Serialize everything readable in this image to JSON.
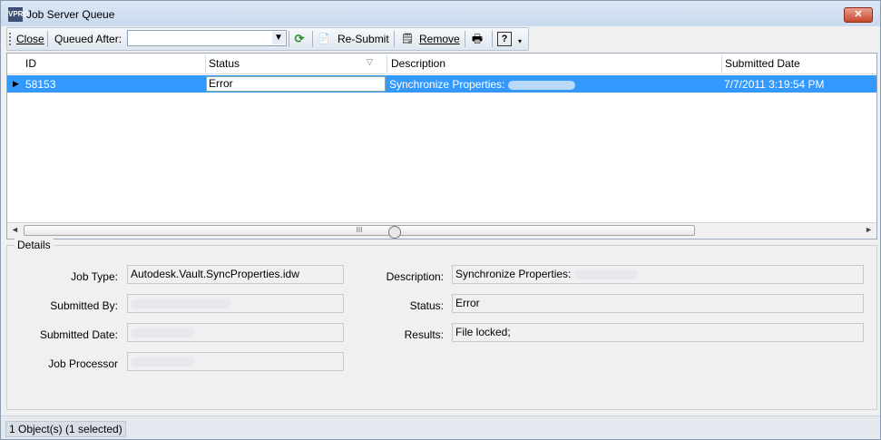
{
  "window": {
    "title": "Job Server Queue",
    "app_icon_label": "VPRO",
    "close_glyph": "✕"
  },
  "toolbar": {
    "close_label": "Close",
    "queued_after_label": "Queued After:",
    "queued_after_value": "",
    "resubmit_label": "Re-Submit",
    "remove_label": "Remove",
    "refresh_icon": "refresh-icon",
    "print_icon": "print-icon",
    "help_icon": "help-icon",
    "help_glyph": "?"
  },
  "grid": {
    "columns": [
      "ID",
      "Status",
      "Description",
      "Submitted Date"
    ],
    "sort_glyph": "▽",
    "rows": [
      {
        "id": "58153",
        "status": "Error",
        "description": "Synchronize Properties:",
        "submitted": "7/7/2011 3:19:54 PM",
        "selected": true
      }
    ],
    "scroll_left": "◄",
    "scroll_right": "►",
    "scroll_grip": "III"
  },
  "details": {
    "legend": "Details",
    "job_type_label": "Job Type:",
    "job_type_value": "Autodesk.Vault.SyncProperties.idw",
    "submitted_by_label": "Submitted By:",
    "submitted_by_value": "",
    "submitted_date_label": "Submitted Date:",
    "submitted_date_value": "",
    "job_processor_label": "Job Processor",
    "job_processor_value": "",
    "description_label": "Description:",
    "description_value": "Synchronize Properties:",
    "status_label": "Status:",
    "status_value": "Error",
    "results_label": "Results:",
    "results_value": "File locked;"
  },
  "statusbar": {
    "text": "1 Object(s) (1 selected)"
  },
  "colors": {
    "selection": "#3399ff",
    "window_bg": "#f0f0f0"
  }
}
